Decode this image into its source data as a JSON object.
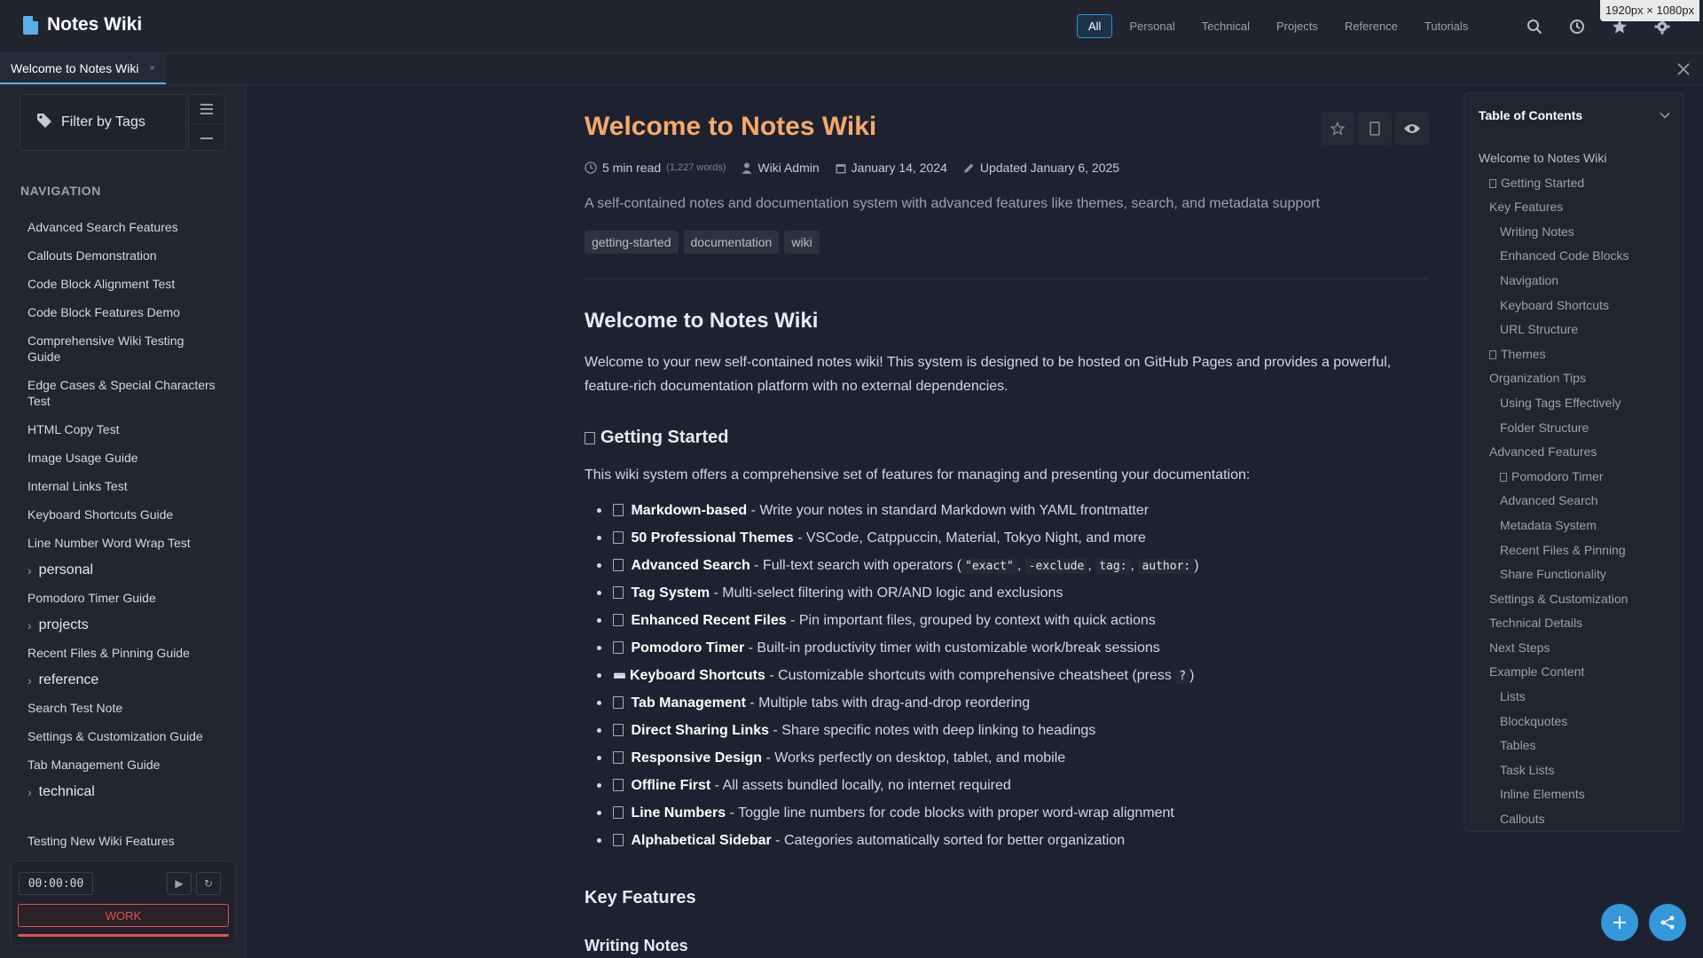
{
  "app": {
    "title": "Notes Wiki",
    "size_badge": "1920px × 1080px"
  },
  "header": {
    "categories": [
      "All",
      "Personal",
      "Technical",
      "Projects",
      "Reference",
      "Tutorials"
    ]
  },
  "tabs": [
    {
      "label": "Welcome to Notes Wiki",
      "close": "×"
    }
  ],
  "sidebar": {
    "filter_label": "Filter by Tags",
    "nav_title": "NAVIGATION",
    "items": [
      "Advanced Search Features",
      "Callouts Demonstration",
      "Code Block Alignment Test",
      "Code Block Features Demo",
      "Comprehensive Wiki Testing Guide",
      "Edge Cases & Special Characters Test",
      "HTML Copy Test",
      "Image Usage Guide",
      "Internal Links Test",
      "Keyboard Shortcuts Guide",
      "Line Number Word Wrap Test",
      "personal",
      "Pomodoro Timer Guide",
      "projects",
      "Recent Files & Pinning Guide",
      "reference",
      "Search Test Note",
      "Settings & Customization Guide",
      "Tab Management Guide",
      "technical",
      "Testing New Wiki Features"
    ],
    "pomodoro": {
      "time": "00:00:00",
      "mode": "WORK",
      "play": "▶",
      "reset": "↻"
    }
  },
  "main": {
    "title": "Welcome to Notes Wiki",
    "meta": {
      "read_time": "5 min read",
      "words": "(1,227 words)",
      "author": "Wiki Admin",
      "date": "January 14, 2024",
      "updated": "Updated January 6, 2025"
    },
    "description": "A self-contained notes and documentation system with advanced features like themes, search, and metadata support",
    "tags": [
      "getting-started",
      "documentation",
      "wiki"
    ],
    "h2_welcome": "Welcome to Notes Wiki",
    "intro": "Welcome to your new self-contained notes wiki! This system is designed to be hosted on GitHub Pages and provides a powerful, feature-rich documentation platform with no external dependencies.",
    "h3_getting_started": "Getting Started",
    "gs_text": "This wiki system offers a comprehensive set of features for managing and presenting your documentation:",
    "features": [
      {
        "name": "Markdown-based",
        "desc": " - Write your notes in standard Markdown with YAML frontmatter"
      },
      {
        "name": "50 Professional Themes",
        "desc": " - VSCode, Catppuccin, Material, Tokyo Night, and more"
      },
      {
        "name": "Advanced Search",
        "desc": " - Full-text search with operators (",
        "codes": [
          "\"exact\"",
          "-exclude",
          "tag:",
          "author:"
        ],
        "tail": ")"
      },
      {
        "name": "Tag System",
        "desc": " - Multi-select filtering with OR/AND logic and exclusions"
      },
      {
        "name": "Enhanced Recent Files",
        "desc": " - Pin important files, grouped by context with quick actions"
      },
      {
        "name": "Pomodoro Timer",
        "desc": " - Built-in productivity timer with customizable work/break sessions"
      },
      {
        "name": "Keyboard Shortcuts",
        "desc": " - Customizable shortcuts with comprehensive cheatsheet (press ",
        "codes": [
          "?"
        ],
        "tail": ")",
        "icon": "⌨️"
      },
      {
        "name": "Tab Management",
        "desc": " - Multiple tabs with drag-and-drop reordering"
      },
      {
        "name": "Direct Sharing Links",
        "desc": " - Share specific notes with deep linking to headings"
      },
      {
        "name": "Responsive Design",
        "desc": " - Works perfectly on desktop, tablet, and mobile"
      },
      {
        "name": "Offline First",
        "desc": " - All assets bundled locally, no internet required"
      },
      {
        "name": "Line Numbers",
        "desc": " - Toggle line numbers for code blocks with proper word-wrap alignment"
      },
      {
        "name": "Alphabetical Sidebar",
        "desc": " - Categories automatically sorted for better organization"
      }
    ],
    "h2_key_features": "Key Features",
    "h3_writing_notes": "Writing Notes"
  },
  "toc": {
    "title": "Table of Contents",
    "items": [
      {
        "label": "Welcome to Notes Wiki",
        "level": 1
      },
      {
        "label": "Getting Started",
        "level": 2,
        "box": true
      },
      {
        "label": "Key Features",
        "level": 2
      },
      {
        "label": "Writing Notes",
        "level": 3
      },
      {
        "label": "Enhanced Code Blocks",
        "level": 3
      },
      {
        "label": "Navigation",
        "level": 3
      },
      {
        "label": "Keyboard Shortcuts",
        "level": 3
      },
      {
        "label": "URL Structure",
        "level": 3
      },
      {
        "label": "Themes",
        "level": 2,
        "box": true
      },
      {
        "label": "Organization Tips",
        "level": 2
      },
      {
        "label": "Using Tags Effectively",
        "level": 3
      },
      {
        "label": "Folder Structure",
        "level": 3
      },
      {
        "label": "Advanced Features",
        "level": 2
      },
      {
        "label": "Pomodoro Timer",
        "level": 3,
        "box": true
      },
      {
        "label": "Advanced Search",
        "level": 3
      },
      {
        "label": "Metadata System",
        "level": 3
      },
      {
        "label": "Recent Files & Pinning",
        "level": 3
      },
      {
        "label": "Share Functionality",
        "level": 3
      },
      {
        "label": "Settings & Customization",
        "level": 2
      },
      {
        "label": "Technical Details",
        "level": 2
      },
      {
        "label": "Next Steps",
        "level": 2
      },
      {
        "label": "Example Content",
        "level": 2
      },
      {
        "label": "Lists",
        "level": 3
      },
      {
        "label": "Blockquotes",
        "level": 3
      },
      {
        "label": "Tables",
        "level": 3
      },
      {
        "label": "Task Lists",
        "level": 3
      },
      {
        "label": "Inline Elements",
        "level": 3
      },
      {
        "label": "Callouts",
        "level": 3
      }
    ]
  },
  "colors": {
    "accent": "#5ab0e6",
    "title": "#f6a96a",
    "work": "#e05252",
    "fab": "#3498db"
  }
}
